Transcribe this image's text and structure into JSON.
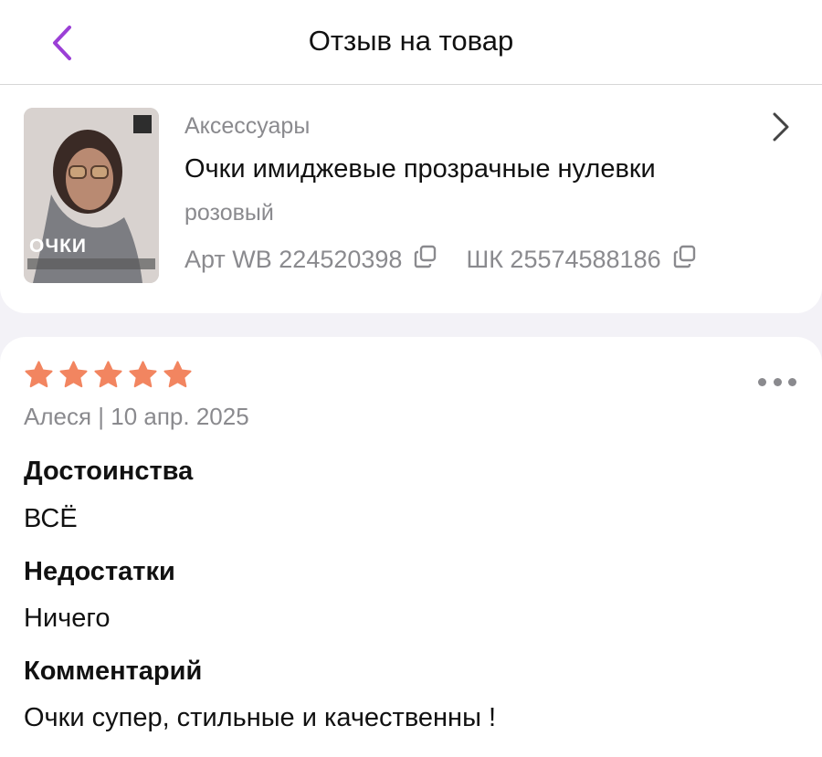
{
  "header": {
    "title": "Отзыв на товар"
  },
  "product": {
    "thumb_text": "ОЧКИ",
    "category": "Аксессуары",
    "name": "Очки имиджевые прозрачные нулевки",
    "variant": "розовый",
    "art_wb": "Арт WB 224520398",
    "barcode": "ШК 25574588186"
  },
  "review": {
    "rating": 5,
    "author_date": "Алеся | 10 апр. 2025",
    "pros_title": "Достоинства",
    "pros_text": "ВСЁ",
    "cons_title": "Недостатки",
    "cons_text": "Ничего",
    "comment_title": "Комментарий",
    "comment_text": "Очки супер, стильные и качественны !"
  },
  "colors": {
    "accent": "#9b3fd6",
    "star": "#f28560",
    "muted": "#8a8a8e"
  },
  "icons": [
    "chevron-left-icon",
    "chevron-right-icon",
    "copy-icon",
    "star-icon",
    "more-dots-icon"
  ]
}
